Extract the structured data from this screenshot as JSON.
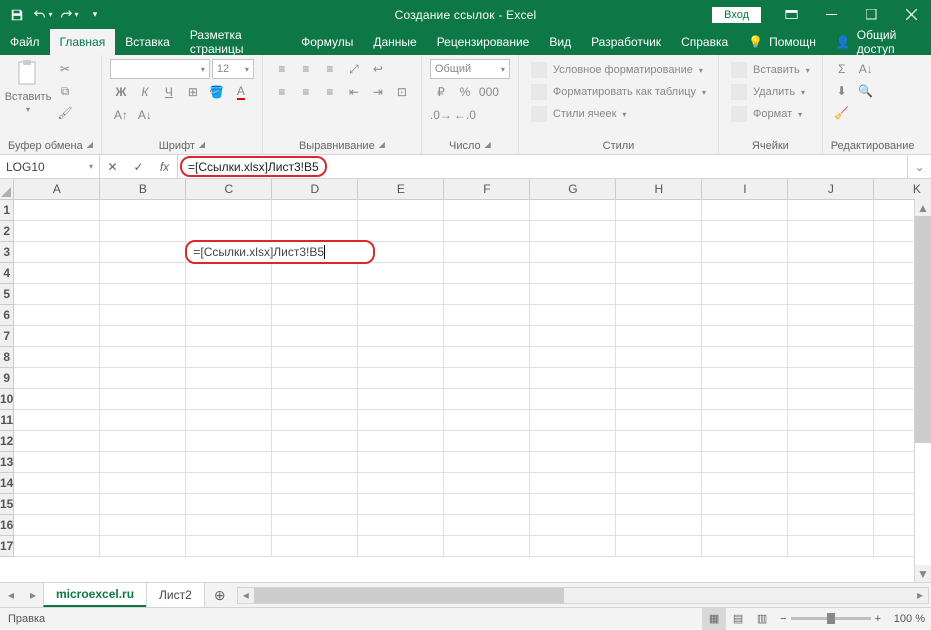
{
  "title": {
    "doc": "Создание ссылок",
    "app": "Excel",
    "signin": "Вход"
  },
  "tabs": {
    "file": "Файл",
    "home": "Главная",
    "insert": "Вставка",
    "layout": "Разметка страницы",
    "formulas": "Формулы",
    "data": "Данные",
    "review": "Рецензирование",
    "view": "Вид",
    "developer": "Разработчик",
    "help": "Справка",
    "tellme": "Помощн",
    "share": "Общий доступ"
  },
  "ribbon": {
    "clipboard": {
      "label": "Буфер обмена",
      "paste": "Вставить"
    },
    "font": {
      "label": "Шрифт",
      "name": "",
      "size": "12"
    },
    "alignment": {
      "label": "Выравнивание"
    },
    "number": {
      "label": "Число",
      "format": "Общий"
    },
    "styles": {
      "label": "Стили",
      "cond": "Условное форматирование",
      "table": "Форматировать как таблицу",
      "cell": "Стили ячеек"
    },
    "cells": {
      "label": "Ячейки",
      "insert": "Вставить",
      "delete": "Удалить",
      "format": "Формат"
    },
    "editing": {
      "label": "Редактирование"
    }
  },
  "namebox": "LOG10",
  "formula": "=[Ссылки.xlsx]Лист3!B5",
  "cellFormula": "=[Ссылки.xlsx]Лист3!B5",
  "columns": [
    "A",
    "B",
    "C",
    "D",
    "E",
    "F",
    "G",
    "H",
    "I",
    "J",
    "K"
  ],
  "rows": [
    "1",
    "2",
    "3",
    "4",
    "5",
    "6",
    "7",
    "8",
    "9",
    "10",
    "11",
    "12",
    "13",
    "14",
    "15",
    "16",
    "17"
  ],
  "sheets": {
    "s1": "microexcel.ru",
    "s2": "Лист2"
  },
  "status": {
    "mode": "Правка",
    "zoom": "100 %"
  }
}
